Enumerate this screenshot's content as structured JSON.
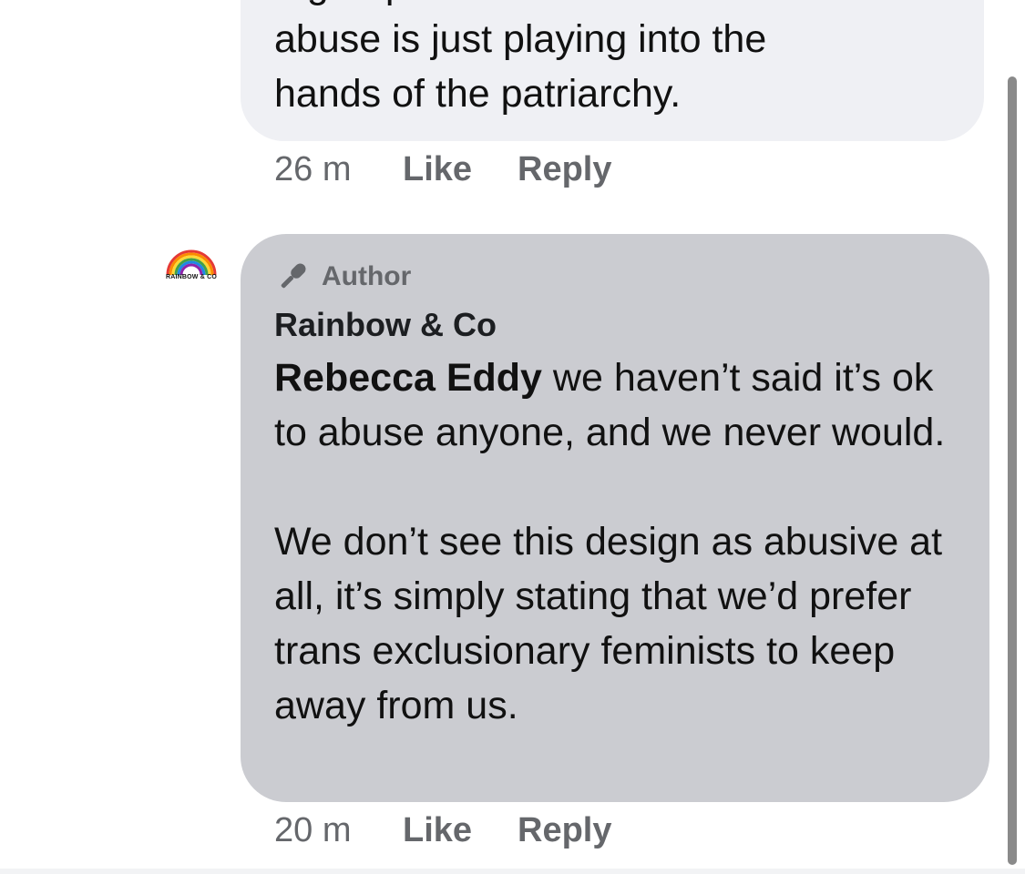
{
  "comments": [
    {
      "body_lines": [
        "a group of women that it is \"ok\" to",
        "abuse is just playing into the",
        "hands of the patriarchy."
      ],
      "time": "26 m",
      "like_label": "Like",
      "reply_label": "Reply"
    },
    {
      "avatar_text": "RAINBOW & CO",
      "badge_icon": "microphone-icon",
      "badge_label": "Author",
      "author": "Rainbow & Co",
      "mention": "Rebecca Eddy",
      "paragraph_1": " we haven’t said it’s ok to abuse anyone, and we never would.",
      "paragraph_2": "We don’t see this design as abusive at all, it’s simply stating that we’d prefer trans exclusionary feminists to keep away from us.",
      "time": "20 m",
      "like_label": "Like",
      "reply_label": "Reply"
    }
  ],
  "colors": {
    "bubble_light": "#eff0f4",
    "bubble_author": "#cbccd1",
    "meta_text": "#65676b",
    "scrollbar": "#8a8a8a"
  }
}
